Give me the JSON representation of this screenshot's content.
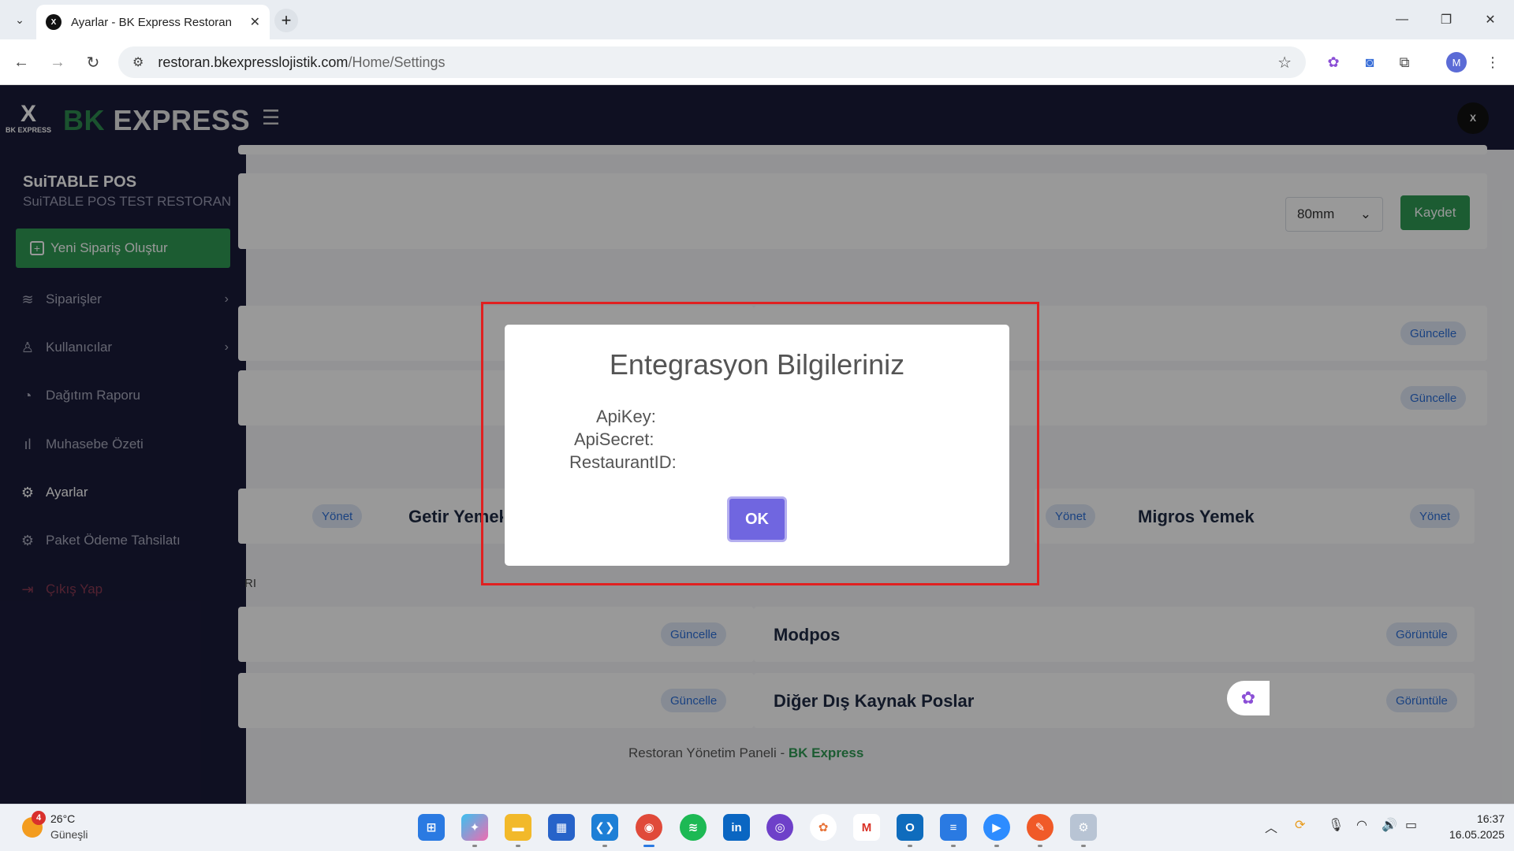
{
  "browser": {
    "tab_title": "Ayarlar - BK Express Restoran",
    "favicon_text": "X",
    "url_host": "restoran.bkexpresslojistik.com",
    "url_path": "/Home/Settings",
    "profile_initial": "M"
  },
  "app": {
    "logo_mark": "X",
    "logo_sub": "BK EXPRESS",
    "logo_bk": "BK",
    "logo_express": "EXPRESS",
    "header_avatar": "X"
  },
  "sidebar": {
    "brand_name": "SuiTABLE POS",
    "brand_sub": "SuiTABLE POS TEST RESTORAN",
    "new_order_label": "Yeni Sipariş Oluştur",
    "items": [
      {
        "label": "Siparişler",
        "icon": "layers-icon"
      },
      {
        "label": "Kullanıcılar",
        "icon": "users-icon"
      },
      {
        "label": "Dağıtım Raporu",
        "icon": "pie-chart-icon"
      },
      {
        "label": "Muhasebe Özeti",
        "icon": "bar-chart-icon"
      },
      {
        "label": "Ayarlar",
        "icon": "gear-icon"
      },
      {
        "label": "Paket Ödeme Tahsilatı",
        "icon": "gear-icon"
      },
      {
        "label": "Çıkış Yap",
        "icon": "logout-icon"
      }
    ]
  },
  "content": {
    "printer_size": "80mm",
    "save_label": "Kaydet",
    "update_label": "Güncelle",
    "manage_label": "Yönet",
    "view_label": "Görüntüle",
    "getir_title": "Getir Yemek",
    "migros_title": "Migros Yemek",
    "modpos_title": "Modpos",
    "other_title": "Diğer Dış Kaynak Poslar",
    "section_fragment": "RI",
    "footer_prefix": "Restoran Yönetim Paneli - ",
    "footer_brand": "BK Express"
  },
  "modal": {
    "title": "Entegrasyon Bilgileriniz",
    "api_key_label": "ApiKey:",
    "api_secret_label": "ApiSecret:",
    "restaurant_id_label": "RestaurantID:",
    "ok_label": "OK"
  },
  "taskbar": {
    "weather_badge": "4",
    "temperature": "26°C",
    "condition": "Güneşli",
    "time": "16:37",
    "date": "16.05.2025"
  },
  "colors": {
    "sidebar_bg": "#1a1b3a",
    "brand_green": "#2f9a54",
    "ok_purple": "#7066e0",
    "highlight_red": "#e02020"
  }
}
